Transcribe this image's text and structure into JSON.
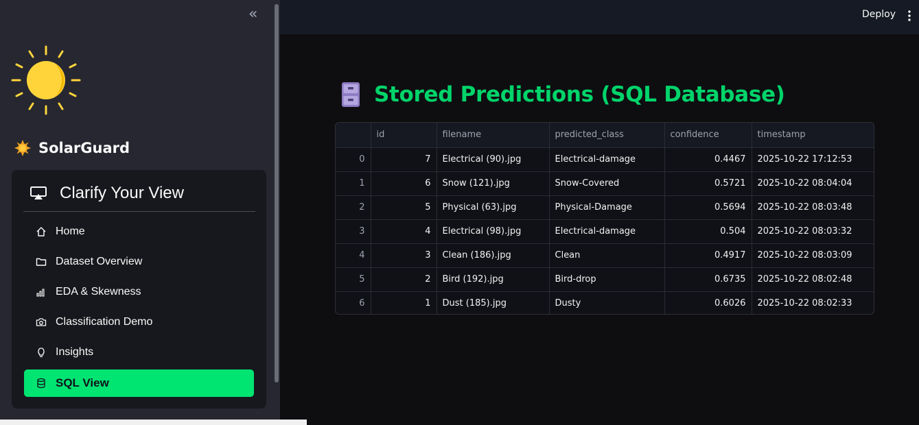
{
  "sidebar": {
    "brand": "SolarGuard",
    "menu_title": "Clarify Your View",
    "items": [
      {
        "label": "Home",
        "icon": "home-icon"
      },
      {
        "label": "Dataset Overview",
        "icon": "folder-icon"
      },
      {
        "label": "EDA & Skewness",
        "icon": "bar-chart-icon"
      },
      {
        "label": "Classification Demo",
        "icon": "camera-icon"
      },
      {
        "label": "Insights",
        "icon": "lightbulb-icon"
      },
      {
        "label": "SQL View",
        "icon": "database-icon",
        "active": true
      }
    ],
    "accent_color": "#00e472"
  },
  "topbar": {
    "deploy_label": "Deploy"
  },
  "main": {
    "title": "Stored Predictions (SQL Database)",
    "title_color": "#00d46a",
    "table": {
      "columns": [
        "",
        "id",
        "filename",
        "predicted_class",
        "confidence",
        "timestamp"
      ],
      "rows": [
        [
          "0",
          "7",
          "Electrical (90).jpg",
          "Electrical-damage",
          "0.4467",
          "2025-10-22 17:12:53"
        ],
        [
          "1",
          "6",
          "Snow (121).jpg",
          "Snow-Covered",
          "0.5721",
          "2025-10-22 08:04:04"
        ],
        [
          "2",
          "5",
          "Physical (63).jpg",
          "Physical-Damage",
          "0.5694",
          "2025-10-22 08:03:48"
        ],
        [
          "3",
          "4",
          "Electrical (98).jpg",
          "Electrical-damage",
          "0.504",
          "2025-10-22 08:03:32"
        ],
        [
          "4",
          "3",
          "Clean (186).jpg",
          "Clean",
          "0.4917",
          "2025-10-22 08:03:09"
        ],
        [
          "5",
          "2",
          "Bird (192).jpg",
          "Bird-drop",
          "0.6735",
          "2025-10-22 08:02:48"
        ],
        [
          "6",
          "1",
          "Dust (185).jpg",
          "Dusty",
          "0.6026",
          "2025-10-22 08:02:33"
        ]
      ]
    }
  }
}
